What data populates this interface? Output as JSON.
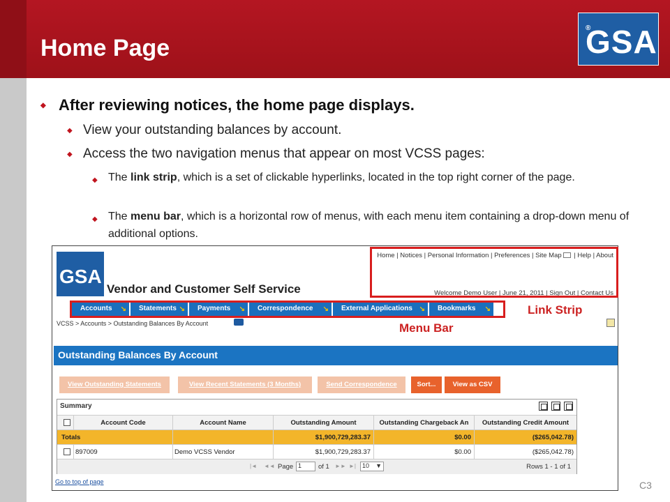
{
  "slide": {
    "title": "Home Page",
    "logo_text": "GSA",
    "logo_mark": "®",
    "slide_number": "C3"
  },
  "bullets": {
    "main": "After reviewing notices, the home page displays.",
    "view_balances": "View your outstanding balances by account.",
    "access_menus": "Access the two navigation menus that appear on most VCSS pages:",
    "link_strip": {
      "pre": "The ",
      "term": "link strip",
      "post": ", which is a set of clickable hyperlinks, located in the top right corner of the page."
    },
    "menu_bar": {
      "pre": "The ",
      "term": "menu bar",
      "post": ", which is a horizontal row of menus, with each menu item containing a drop-down menu of additional options."
    }
  },
  "screenshot": {
    "logo_text": "GSA",
    "site_title": "Vendor and Customer Self Service",
    "link_strip": {
      "top_links": [
        "Home",
        "Notices",
        "Personal Information",
        "Preferences",
        "Site Map",
        "Help",
        "About"
      ],
      "welcome": "Welcome Demo User",
      "date": "June 21, 2011",
      "sign_out": "Sign Out",
      "contact": "Contact Us"
    },
    "menu": [
      "Accounts",
      "Statements",
      "Payments",
      "Correspondence",
      "External Applications",
      "Bookmarks"
    ],
    "breadcrumb": "VCSS > Accounts > Outstanding Balances By Account",
    "page_heading": "Outstanding Balances By Account",
    "actions": {
      "view_outstanding": "View Outstanding Statements",
      "view_recent": "View Recent Statements (3 Months)",
      "send_correspondence": "Send Correspondence",
      "sort": "Sort...",
      "view_csv": "View as CSV"
    },
    "grid": {
      "caption": "Summary",
      "columns": [
        "Account Code",
        "Account Name",
        "Outstanding Amount",
        "Outstanding Chargeback An",
        "Outstanding Credit Amount"
      ],
      "totals": {
        "label": "Totals",
        "outstanding": "$1,900,729,283.37",
        "chargeback": "$0.00",
        "credit": "($265,042.78)"
      },
      "rows": [
        {
          "code": "897009",
          "name": "Demo VCSS Vendor",
          "outstanding": "$1,900,729,283.37",
          "chargeback": "$0.00",
          "credit": "($265,042.78)"
        }
      ],
      "pager": {
        "page_label": "Page",
        "page_value": "1",
        "of_label": "of 1",
        "page_size": "10",
        "rows_text": "Rows 1 - 1 of 1"
      }
    },
    "go_top": "Go to top of page"
  },
  "callouts": {
    "link_strip": "Link Strip",
    "menu_bar": "Menu Bar"
  },
  "colors": {
    "title_band": "#b41622",
    "callout": "#d81e1e",
    "menu_blue": "#1a6fbd",
    "totals_row": "#f3b52a",
    "action_active": "#e8622c"
  }
}
